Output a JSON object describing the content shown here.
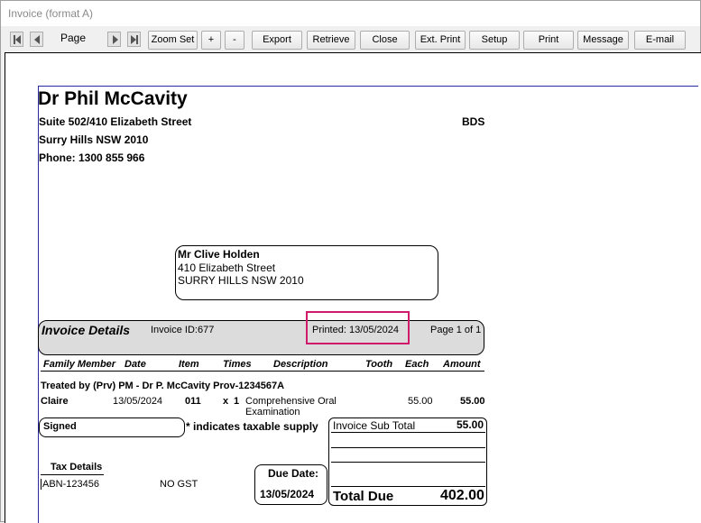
{
  "window": {
    "title": "Invoice (format A)"
  },
  "toolbar": {
    "page_label": "Page",
    "zoom_set": "Zoom Set",
    "zoom_in": "+",
    "zoom_out": "-",
    "export": "Export",
    "retrieve": "Retrieve",
    "close": "Close",
    "ext_print": "Ext. Print",
    "setup": "Setup",
    "print": "Print",
    "message": "Message",
    "email": "E-mail"
  },
  "practice": {
    "name": "Dr Phil McCavity",
    "address1": "Suite 502/410 Elizabeth Street",
    "address2": "Surry Hills NSW 2010",
    "phone": "Phone: 1300 855 966",
    "code": "BDS"
  },
  "recipient": {
    "name": "Mr Clive  Holden",
    "address1": "410 Elizabeth Street",
    "address2": "SURRY HILLS NSW 2010"
  },
  "invoice_header": {
    "title": "Invoice Details",
    "invoice_id": "Invoice ID:677",
    "printed": "Printed: 13/05/2024",
    "page": "Page 1 of 1"
  },
  "columns": {
    "family_member": "Family Member",
    "date": "Date",
    "item": "Item",
    "times": "Times",
    "description": "Description",
    "tooth": "Tooth",
    "each": "Each",
    "amount": "Amount"
  },
  "treated_by": "Treated by (Prv) PM - Dr P. McCavity Prov-1234567A",
  "line_item": {
    "member": "Claire",
    "date": "13/05/2024",
    "item": "011",
    "times_x": "x",
    "times": "1",
    "description_1": "Comprehensive Oral",
    "description_2": "Examination",
    "each": "55.00",
    "amount": "55.00"
  },
  "signed_label": "Signed",
  "taxable_note": "* indicates taxable supply",
  "totals": {
    "sub_total_label": "Invoice Sub Total",
    "sub_total": "55.00",
    "total_due_label": "Total Due",
    "total_due": "402.00"
  },
  "tax": {
    "heading": "Tax Details",
    "abn": "ABN-123456",
    "gst": "NO GST"
  },
  "due": {
    "label": "Due Date:",
    "date": "13/05/2024"
  },
  "colors": {
    "highlight": "#d11a6b",
    "margin_line": "#2a2aa0"
  }
}
